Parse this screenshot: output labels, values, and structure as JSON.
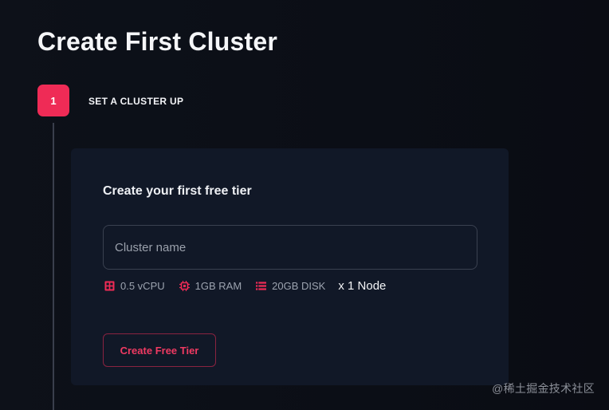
{
  "page": {
    "title": "Create First Cluster"
  },
  "step": {
    "number": "1",
    "label": "SET A CLUSTER UP"
  },
  "card": {
    "title": "Create your first free tier",
    "name_input": {
      "placeholder": "Cluster name",
      "value": ""
    },
    "specs": [
      {
        "icon": "cpu-grid-icon",
        "label": "0.5 vCPU"
      },
      {
        "icon": "chip-icon",
        "label": "1GB RAM"
      },
      {
        "icon": "list-disk-icon",
        "label": "20GB DISK"
      }
    ],
    "node_count": "x 1 Node",
    "create_button_label": "Create Free Tier"
  },
  "watermark": "@稀土掘金技术社区",
  "colors": {
    "accent": "#ef2b56",
    "background": "#0b0d14",
    "card": "#111827",
    "muted_text": "#9ca3af"
  }
}
